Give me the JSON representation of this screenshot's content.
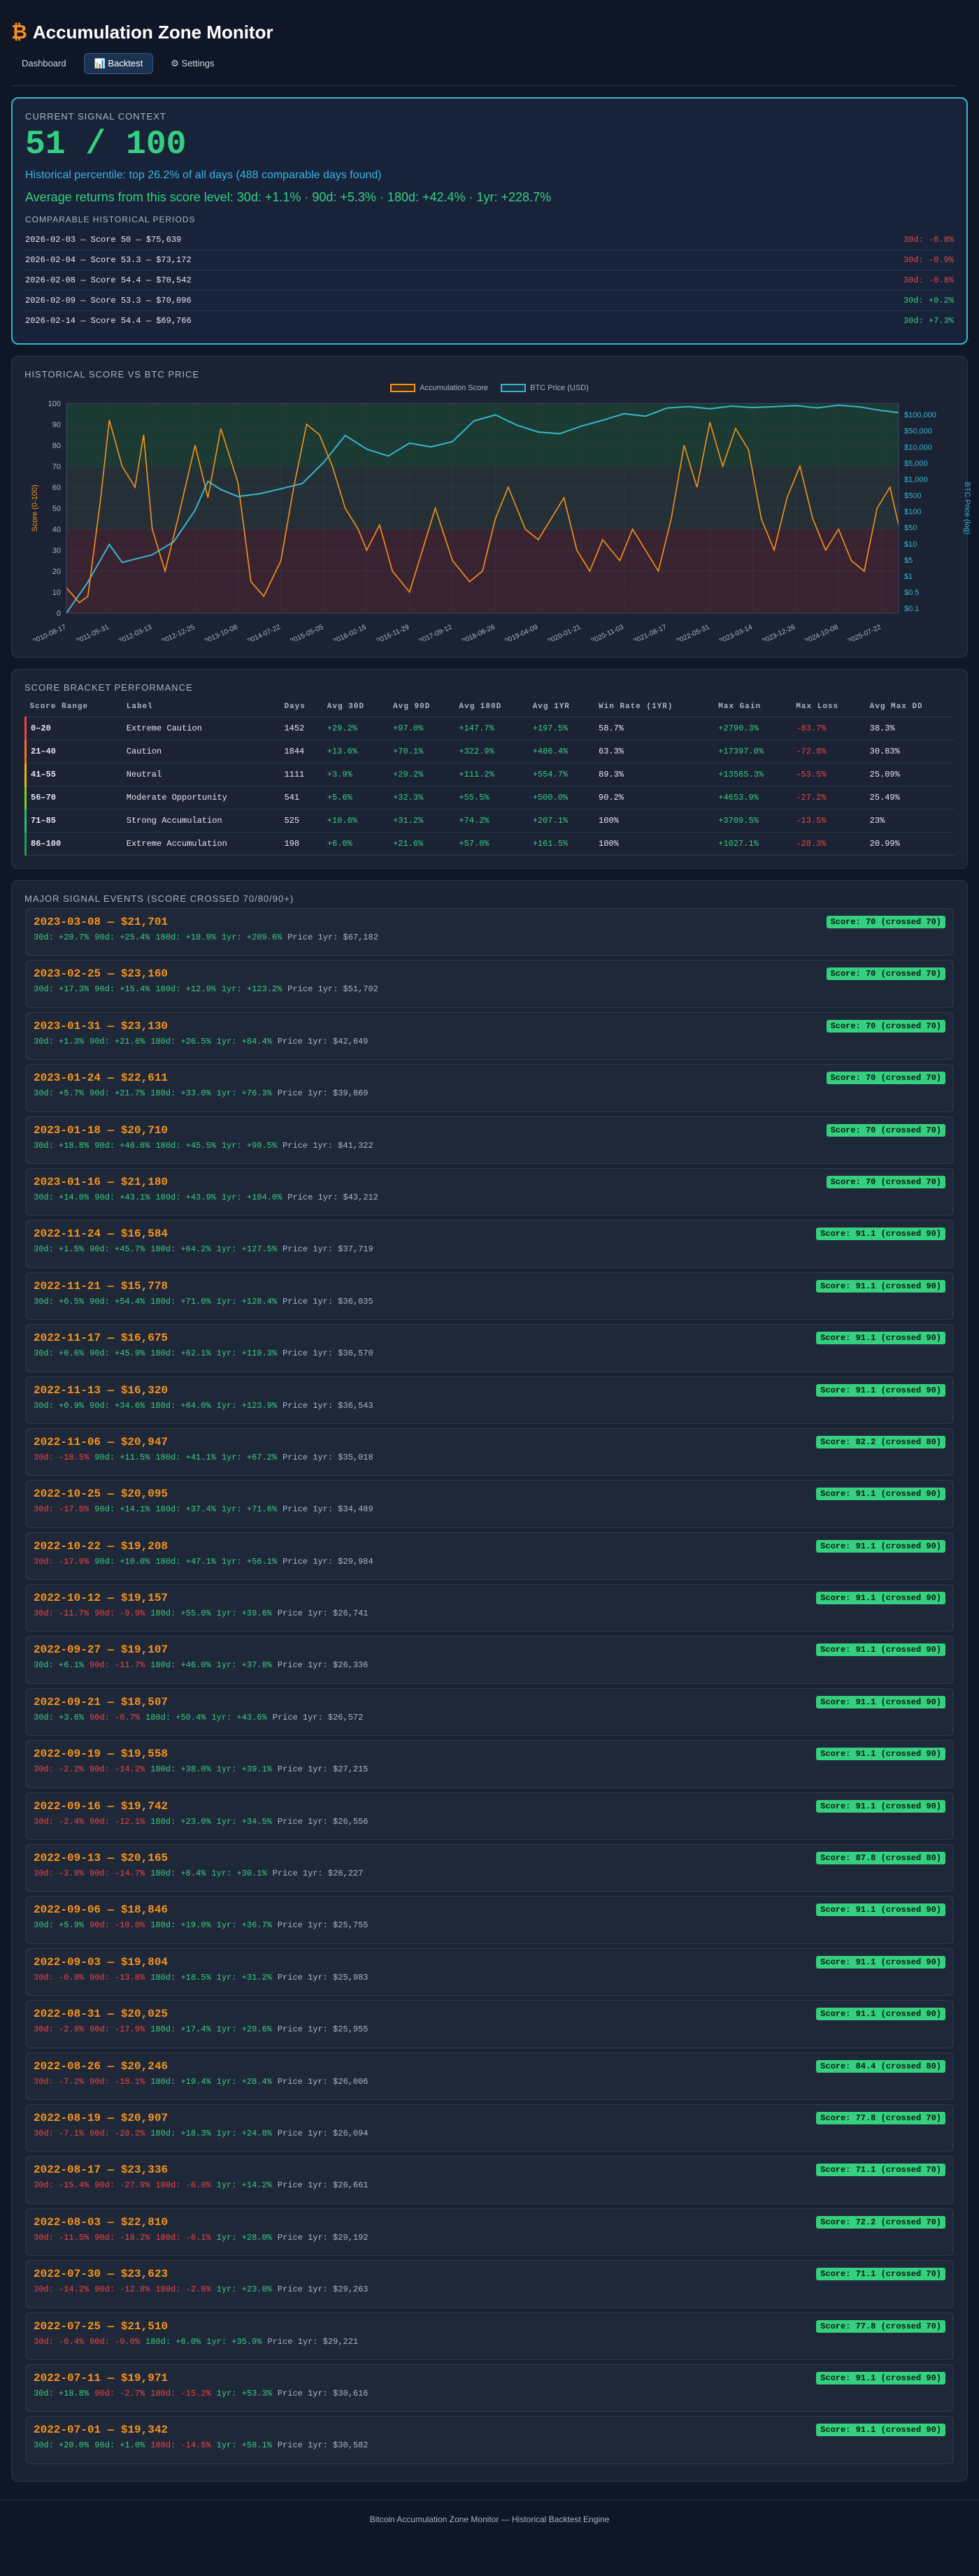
{
  "header": {
    "title": "Accumulation Zone Monitor",
    "logo_symbol": "₿",
    "tabs": [
      {
        "label": "Dashboard"
      },
      {
        "label": "📊 Backtest"
      },
      {
        "label": "⚙ Settings"
      }
    ]
  },
  "context": {
    "title": "Current Signal Context",
    "score": "51 / 100",
    "percentile": "Historical percentile: top 26.2% of all days (488 comparable days found)",
    "avg_returns": "Average returns from this score level: 30d: +1.1% · 90d: +5.3% · 180d: +42.4% · 1yr: +228.7%",
    "comparable_title": "Comparable Historical Periods",
    "comparable": [
      {
        "label": "2026-02-03 — Score 50 — $75,639",
        "ret": "30d: -6.8%",
        "sign": "neg"
      },
      {
        "label": "2026-02-04 — Score 53.3 — $73,172",
        "ret": "30d: -0.9%",
        "sign": "neg"
      },
      {
        "label": "2026-02-08 — Score 54.4 — $70,542",
        "ret": "30d: -0.8%",
        "sign": "neg"
      },
      {
        "label": "2026-02-09 — Score 53.3 — $70,096",
        "ret": "30d: +0.2%",
        "sign": "pos"
      },
      {
        "label": "2026-02-14 — Score 54.4 — $69,766",
        "ret": "30d: +7.3%",
        "sign": "pos"
      }
    ]
  },
  "chart_section": {
    "title": "Historical Score vs BTC Price"
  },
  "chart_data": {
    "type": "line",
    "series": [
      {
        "name": "Accumulation Score",
        "color": "#f7931a"
      },
      {
        "name": "BTC Price (USD)",
        "color": "#35b6cf"
      }
    ],
    "ylabel": "Score (0-100)",
    "y2label": "BTC Price (log)",
    "ylim": [
      0,
      100
    ],
    "yticks": [
      0,
      10,
      20,
      30,
      40,
      50,
      60,
      70,
      80,
      90,
      100
    ],
    "y2ticks": [
      "$0.1",
      "$0.5",
      "$1",
      "$5",
      "$10",
      "$50",
      "$100",
      "$500",
      "$1,000",
      "$5,000",
      "$10,000",
      "$50,000",
      "$100,000"
    ],
    "xticks": [
      "2010-08-17",
      "2011-05-31",
      "2012-03-13",
      "2012-12-25",
      "2013-10-08",
      "2014-07-22",
      "2015-05-05",
      "2016-02-16",
      "2016-11-29",
      "2017-09-12",
      "2018-06-26",
      "2019-04-09",
      "2020-01-21",
      "2020-11-03",
      "2021-08-17",
      "2022-05-31",
      "2023-03-14",
      "2023-12-26",
      "2024-10-08",
      "2025-07-22"
    ],
    "bands": [
      {
        "from": 0,
        "to": 40,
        "color": "#3a2330"
      },
      {
        "from": 40,
        "to": 70,
        "color": "#243036"
      },
      {
        "from": 70,
        "to": 100,
        "color": "#1b3a32"
      }
    ],
    "score_points": [
      [
        0,
        12
      ],
      [
        0.3,
        5
      ],
      [
        0.5,
        8
      ],
      [
        0.8,
        55
      ],
      [
        1,
        92
      ],
      [
        1.3,
        70
      ],
      [
        1.6,
        60
      ],
      [
        1.8,
        85
      ],
      [
        2,
        40
      ],
      [
        2.3,
        20
      ],
      [
        2.6,
        45
      ],
      [
        3,
        80
      ],
      [
        3.3,
        55
      ],
      [
        3.6,
        88
      ],
      [
        4,
        62
      ],
      [
        4.3,
        15
      ],
      [
        4.6,
        8
      ],
      [
        5,
        25
      ],
      [
        5.3,
        60
      ],
      [
        5.6,
        90
      ],
      [
        5.9,
        85
      ],
      [
        6.2,
        70
      ],
      [
        6.5,
        50
      ],
      [
        6.8,
        40
      ],
      [
        7,
        30
      ],
      [
        7.3,
        42
      ],
      [
        7.6,
        20
      ],
      [
        8,
        10
      ],
      [
        8.3,
        30
      ],
      [
        8.6,
        50
      ],
      [
        9,
        25
      ],
      [
        9.4,
        15
      ],
      [
        9.7,
        20
      ],
      [
        10,
        45
      ],
      [
        10.3,
        60
      ],
      [
        10.7,
        40
      ],
      [
        11,
        35
      ],
      [
        11.3,
        45
      ],
      [
        11.6,
        55
      ],
      [
        11.9,
        30
      ],
      [
        12.2,
        20
      ],
      [
        12.5,
        35
      ],
      [
        12.9,
        25
      ],
      [
        13.2,
        40
      ],
      [
        13.5,
        30
      ],
      [
        13.8,
        20
      ],
      [
        14.1,
        45
      ],
      [
        14.4,
        80
      ],
      [
        14.7,
        60
      ],
      [
        15,
        91
      ],
      [
        15.3,
        70
      ],
      [
        15.6,
        88
      ],
      [
        15.9,
        78
      ],
      [
        16.2,
        45
      ],
      [
        16.5,
        30
      ],
      [
        16.8,
        55
      ],
      [
        17.1,
        70
      ],
      [
        17.4,
        45
      ],
      [
        17.7,
        30
      ],
      [
        18,
        40
      ],
      [
        18.3,
        25
      ],
      [
        18.6,
        20
      ],
      [
        18.9,
        50
      ],
      [
        19.2,
        60
      ],
      [
        19.4,
        42
      ]
    ],
    "price_points": [
      [
        0,
        0.1
      ],
      [
        0.5,
        0.8
      ],
      [
        1,
        10
      ],
      [
        1.3,
        3
      ],
      [
        2,
        5
      ],
      [
        2.5,
        12
      ],
      [
        3,
        100
      ],
      [
        3.3,
        700
      ],
      [
        3.6,
        400
      ],
      [
        4,
        250
      ],
      [
        4.5,
        300
      ],
      [
        5,
        420
      ],
      [
        5.5,
        600
      ],
      [
        6,
        2500
      ],
      [
        6.5,
        15000
      ],
      [
        7,
        6000
      ],
      [
        7.5,
        3800
      ],
      [
        8,
        9000
      ],
      [
        8.5,
        7000
      ],
      [
        9,
        10000
      ],
      [
        9.5,
        40000
      ],
      [
        10,
        60000
      ],
      [
        10.5,
        30000
      ],
      [
        11,
        19000
      ],
      [
        11.5,
        17000
      ],
      [
        12,
        28000
      ],
      [
        12.5,
        42000
      ],
      [
        13,
        65000
      ],
      [
        13.5,
        55000
      ],
      [
        14,
        95000
      ],
      [
        14.5,
        105000
      ],
      [
        15,
        90000
      ],
      [
        15.5,
        108000
      ],
      [
        16,
        98000
      ],
      [
        16.5,
        104000
      ],
      [
        17,
        112000
      ],
      [
        17.5,
        96000
      ],
      [
        18,
        115000
      ],
      [
        18.5,
        102000
      ],
      [
        19,
        80000
      ],
      [
        19.4,
        70000
      ]
    ]
  },
  "brackets": {
    "title": "Score Bracket Performance",
    "headers": [
      "Score Range",
      "Label",
      "Days",
      "Avg 30D",
      "Avg 90D",
      "Avg 180D",
      "Avg 1YR",
      "Win Rate (1YR)",
      "Max Gain",
      "Max Loss",
      "Avg Max DD"
    ],
    "rows": [
      {
        "range": "0–20",
        "label": "Extreme Caution",
        "days": "1452",
        "a30": "+29.2%",
        "a90": "+97.0%",
        "a180": "+147.7%",
        "a1y": "+197.5%",
        "win": "58.7%",
        "gain": "+2790.3%",
        "loss": "-83.7%",
        "dd": "38.3%",
        "neg30": false,
        "color": "#ef4444"
      },
      {
        "range": "21–40",
        "label": "Caution",
        "days": "1844",
        "a30": "+13.6%",
        "a90": "+70.1%",
        "a180": "+322.9%",
        "a1y": "+486.4%",
        "win": "63.3%",
        "gain": "+17397.0%",
        "loss": "-72.8%",
        "dd": "30.83%",
        "neg30": false,
        "color": "#f97316"
      },
      {
        "range": "41–55",
        "label": "Neutral",
        "days": "1111",
        "a30": "+3.9%",
        "a90": "+29.2%",
        "a180": "+111.2%",
        "a1y": "+554.7%",
        "win": "89.3%",
        "gain": "+13565.3%",
        "loss": "-53.5%",
        "dd": "25.09%",
        "neg30": false,
        "color": "#eab308"
      },
      {
        "range": "56–70",
        "label": "Moderate Opportunity",
        "days": "541",
        "a30": "+5.6%",
        "a90": "+32.3%",
        "a180": "+55.5%",
        "a1y": "+500.0%",
        "win": "90.2%",
        "gain": "+4653.9%",
        "loss": "-27.2%",
        "dd": "25.49%",
        "neg30": false,
        "color": "#84cc16"
      },
      {
        "range": "71–85",
        "label": "Strong Accumulation",
        "days": "525",
        "a30": "+10.6%",
        "a90": "+31.2%",
        "a180": "+74.2%",
        "a1y": "+207.1%",
        "win": "100%",
        "gain": "+3709.5%",
        "loss": "-13.5%",
        "dd": "23%",
        "neg30": false,
        "color": "#22c55e"
      },
      {
        "range": "86–100",
        "label": "Extreme Accumulation",
        "days": "198",
        "a30": "+6.0%",
        "a90": "+21.6%",
        "a180": "+57.0%",
        "a1y": "+161.5%",
        "win": "100%",
        "gain": "+1027.1%",
        "loss": "-28.3%",
        "dd": "20.99%",
        "neg30": false,
        "color": "#16a34a"
      }
    ]
  },
  "events": {
    "title": "Major Signal Events (Score Crossed 70/80/90+)",
    "items": [
      {
        "head": "2023-03-08 — $21,701",
        "badge": "Score: 70 (crossed 70)",
        "r": [
          "30d: +20.7%",
          "90d: +25.4%",
          "180d: +18.9%",
          "1yr: +209.6%"
        ],
        "price": "Price 1yr: $67,182"
      },
      {
        "head": "2023-02-25 — $23,160",
        "badge": "Score: 70 (crossed 70)",
        "r": [
          "30d: +17.3%",
          "90d: +15.4%",
          "180d: +12.9%",
          "1yr: +123.2%"
        ],
        "price": "Price 1yr: $51,702"
      },
      {
        "head": "2023-01-31 — $23,130",
        "badge": "Score: 70 (crossed 70)",
        "r": [
          "30d: +1.3%",
          "90d: +21.6%",
          "180d: +26.5%",
          "1yr: +84.4%"
        ],
        "price": "Price 1yr: $42,649"
      },
      {
        "head": "2023-01-24 — $22,611",
        "badge": "Score: 70 (crossed 70)",
        "r": [
          "30d: +5.7%",
          "90d: +21.7%",
          "180d: +33.0%",
          "1yr: +76.3%"
        ],
        "price": "Price 1yr: $39,869"
      },
      {
        "head": "2023-01-18 — $20,710",
        "badge": "Score: 70 (crossed 70)",
        "r": [
          "30d: +18.8%",
          "90d: +46.6%",
          "180d: +45.5%",
          "1yr: +99.5%"
        ],
        "price": "Price 1yr: $41,322"
      },
      {
        "head": "2023-01-16 — $21,180",
        "badge": "Score: 70 (crossed 70)",
        "r": [
          "30d: +14.0%",
          "90d: +43.1%",
          "180d: +43.9%",
          "1yr: +104.0%"
        ],
        "price": "Price 1yr: $43,212"
      },
      {
        "head": "2022-11-24 — $16,584",
        "badge": "Score: 91.1 (crossed 90)",
        "r": [
          "30d: +1.5%",
          "90d: +45.7%",
          "180d: +64.2%",
          "1yr: +127.5%"
        ],
        "price": "Price 1yr: $37,719"
      },
      {
        "head": "2022-11-21 — $15,778",
        "badge": "Score: 91.1 (crossed 90)",
        "r": [
          "30d: +6.5%",
          "90d: +54.4%",
          "180d: +71.0%",
          "1yr: +128.4%"
        ],
        "price": "Price 1yr: $36,035"
      },
      {
        "head": "2022-11-17 — $16,675",
        "badge": "Score: 91.1 (crossed 90)",
        "r": [
          "30d: +0.6%",
          "90d: +45.9%",
          "180d: +62.1%",
          "1yr: +119.3%"
        ],
        "price": "Price 1yr: $36,570"
      },
      {
        "head": "2022-11-13 — $16,320",
        "badge": "Score: 91.1 (crossed 90)",
        "r": [
          "30d: +0.9%",
          "90d: +34.6%",
          "180d: +64.0%",
          "1yr: +123.9%"
        ],
        "price": "Price 1yr: $36,543"
      },
      {
        "head": "2022-11-06 — $20,947",
        "badge": "Score: 82.2 (crossed 80)",
        "r": [
          "30d: -18.5%",
          "90d: +11.5%",
          "180d: +41.1%",
          "1yr: +67.2%"
        ],
        "price": "Price 1yr: $35,018"
      },
      {
        "head": "2022-10-25 — $20,095",
        "badge": "Score: 91.1 (crossed 90)",
        "r": [
          "30d: -17.5%",
          "90d: +14.1%",
          "180d: +37.4%",
          "1yr: +71.6%"
        ],
        "price": "Price 1yr: $34,489"
      },
      {
        "head": "2022-10-22 — $19,208",
        "badge": "Score: 91.1 (crossed 90)",
        "r": [
          "30d: -17.9%",
          "90d: +10.0%",
          "180d: +47.1%",
          "1yr: +56.1%"
        ],
        "price": "Price 1yr: $29,984"
      },
      {
        "head": "2022-10-12 — $19,157",
        "badge": "Score: 91.1 (crossed 90)",
        "r": [
          "30d: -11.7%",
          "90d: -9.9%",
          "180d: +55.0%",
          "1yr: +39.6%"
        ],
        "price": "Price 1yr: $26,741"
      },
      {
        "head": "2022-09-27 — $19,107",
        "badge": "Score: 91.1 (crossed 90)",
        "r": [
          "30d: +6.1%",
          "90d: -11.7%",
          "180d: +46.0%",
          "1yr: +37.8%"
        ],
        "price": "Price 1yr: $26,336"
      },
      {
        "head": "2022-09-21 — $18,507",
        "badge": "Score: 91.1 (crossed 90)",
        "r": [
          "30d: +3.6%",
          "90d: -8.7%",
          "180d: +50.4%",
          "1yr: +43.6%"
        ],
        "price": "Price 1yr: $26,572"
      },
      {
        "head": "2022-09-19 — $19,558",
        "badge": "Score: 91.1 (crossed 90)",
        "r": [
          "30d: -2.2%",
          "90d: -14.2%",
          "180d: +38.0%",
          "1yr: +39.1%"
        ],
        "price": "Price 1yr: $27,215"
      },
      {
        "head": "2022-09-16 — $19,742",
        "badge": "Score: 91.1 (crossed 90)",
        "r": [
          "30d: -2.4%",
          "90d: -12.1%",
          "180d: +23.0%",
          "1yr: +34.5%"
        ],
        "price": "Price 1yr: $26,556"
      },
      {
        "head": "2022-09-13 — $20,165",
        "badge": "Score: 87.8 (crossed 80)",
        "r": [
          "30d: -3.9%",
          "90d: -14.7%",
          "180d: +8.4%",
          "1yr: +30.1%"
        ],
        "price": "Price 1yr: $26,227"
      },
      {
        "head": "2022-09-06 — $18,846",
        "badge": "Score: 91.1 (crossed 90)",
        "r": [
          "30d: +5.9%",
          "90d: -10.0%",
          "180d: +19.0%",
          "1yr: +36.7%"
        ],
        "price": "Price 1yr: $25,755"
      },
      {
        "head": "2022-09-03 — $19,804",
        "badge": "Score: 91.1 (crossed 90)",
        "r": [
          "30d: -0.9%",
          "90d: -13.8%",
          "180d: +18.5%",
          "1yr: +31.2%"
        ],
        "price": "Price 1yr: $25,983"
      },
      {
        "head": "2022-08-31 — $20,025",
        "badge": "Score: 91.1 (crossed 90)",
        "r": [
          "30d: -2.9%",
          "90d: -17.9%",
          "180d: +17.4%",
          "1yr: +29.6%"
        ],
        "price": "Price 1yr: $25,955"
      },
      {
        "head": "2022-08-26 — $20,246",
        "badge": "Score: 84.4 (crossed 80)",
        "r": [
          "30d: -7.2%",
          "90d: -18.1%",
          "180d: +19.4%",
          "1yr: +28.4%"
        ],
        "price": "Price 1yr: $26,006"
      },
      {
        "head": "2022-08-19 — $20,907",
        "badge": "Score: 77.8 (crossed 70)",
        "r": [
          "30d: -7.1%",
          "90d: -20.2%",
          "180d: +18.3%",
          "1yr: +24.8%"
        ],
        "price": "Price 1yr: $26,094"
      },
      {
        "head": "2022-08-17 — $23,336",
        "badge": "Score: 71.1 (crossed 70)",
        "r": [
          "30d: -15.4%",
          "90d: -27.9%",
          "180d: -6.0%",
          "1yr: +14.2%"
        ],
        "price": "Price 1yr: $26,661"
      },
      {
        "head": "2022-08-03 — $22,810",
        "badge": "Score: 72.2 (crossed 70)",
        "r": [
          "30d: -11.5%",
          "90d: -18.2%",
          "180d: -6.1%",
          "1yr: +28.0%"
        ],
        "price": "Price 1yr: $29,192"
      },
      {
        "head": "2022-07-30 — $23,623",
        "badge": "Score: 71.1 (crossed 70)",
        "r": [
          "30d: -14.2%",
          "90d: -12.8%",
          "180d: -2.6%",
          "1yr: +23.0%"
        ],
        "price": "Price 1yr: $29,263"
      },
      {
        "head": "2022-07-25 — $21,510",
        "badge": "Score: 77.8 (crossed 70)",
        "r": [
          "30d: -0.4%",
          "90d: -9.0%",
          "180d: +6.0%",
          "1yr: +35.9%"
        ],
        "price": "Price 1yr: $29,221"
      },
      {
        "head": "2022-07-11 — $19,971",
        "badge": "Score: 91.1 (crossed 90)",
        "r": [
          "30d: +18.8%",
          "90d: -2.7%",
          "180d: -15.2%",
          "1yr: +53.3%"
        ],
        "price": "Price 1yr: $30,616"
      },
      {
        "head": "2022-07-01 — $19,342",
        "badge": "Score: 91.1 (crossed 90)",
        "r": [
          "30d: +20.0%",
          "90d: +1.0%",
          "180d: -14.5%",
          "1yr: +58.1%"
        ],
        "price": "Price 1yr: $30,582"
      }
    ]
  },
  "footer": {
    "text": "Bitcoin Accumulation Zone Monitor — Historical Backtest Engine"
  }
}
